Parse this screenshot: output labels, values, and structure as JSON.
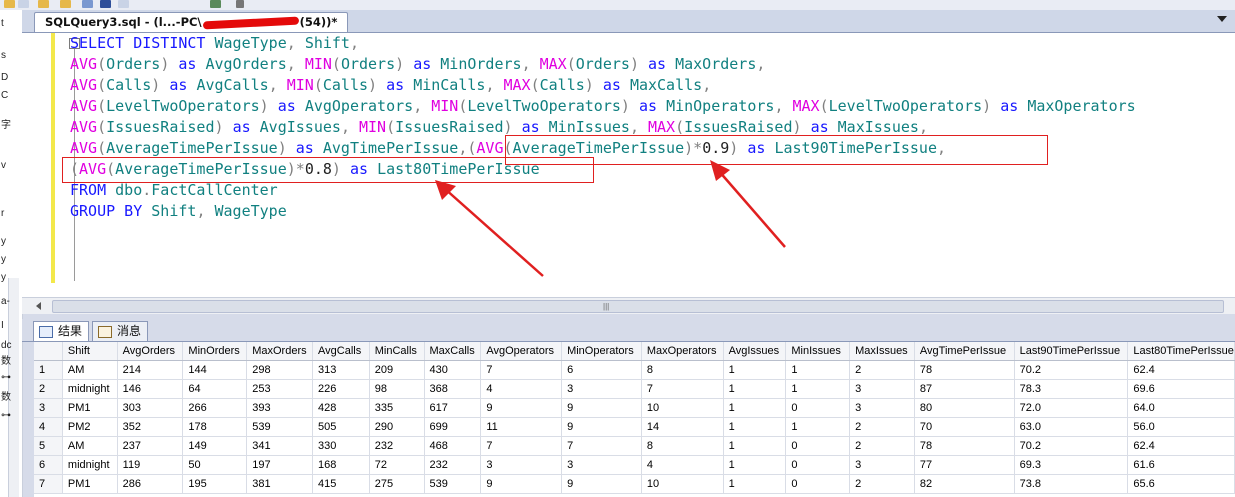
{
  "window": {
    "tab_title_prefix": "SQLQuery3.sql - (l...-PC\\",
    "tab_title_suffix": "(54))*"
  },
  "left_strip_glyphs": [
    "t",
    "s",
    "D",
    "C",
    "字",
    "v",
    "r",
    "y",
    "y",
    "y",
    "a-",
    "I",
    "dc",
    "数",
    "⊶",
    "数",
    "⊶"
  ],
  "editor": {
    "lines": [
      [
        {
          "t": "SELECT DISTINCT ",
          "c": "kw"
        },
        {
          "t": "WageType",
          "c": "id"
        },
        {
          "t": ", ",
          "c": "op"
        },
        {
          "t": "Shift",
          "c": "id"
        },
        {
          "t": ",",
          "c": "op"
        }
      ],
      [
        {
          "t": "AVG",
          "c": "fn"
        },
        {
          "t": "(",
          "c": "op"
        },
        {
          "t": "Orders",
          "c": "id"
        },
        {
          "t": ") ",
          "c": "op"
        },
        {
          "t": "as ",
          "c": "kw"
        },
        {
          "t": "AvgOrders",
          "c": "id"
        },
        {
          "t": ", ",
          "c": "op"
        },
        {
          "t": "MIN",
          "c": "fn"
        },
        {
          "t": "(",
          "c": "op"
        },
        {
          "t": "Orders",
          "c": "id"
        },
        {
          "t": ") ",
          "c": "op"
        },
        {
          "t": "as ",
          "c": "kw"
        },
        {
          "t": "MinOrders",
          "c": "id"
        },
        {
          "t": ", ",
          "c": "op"
        },
        {
          "t": "MAX",
          "c": "fn"
        },
        {
          "t": "(",
          "c": "op"
        },
        {
          "t": "Orders",
          "c": "id"
        },
        {
          "t": ") ",
          "c": "op"
        },
        {
          "t": "as ",
          "c": "kw"
        },
        {
          "t": "MaxOrders",
          "c": "id"
        },
        {
          "t": ",",
          "c": "op"
        }
      ],
      [
        {
          "t": "AVG",
          "c": "fn"
        },
        {
          "t": "(",
          "c": "op"
        },
        {
          "t": "Calls",
          "c": "id"
        },
        {
          "t": ") ",
          "c": "op"
        },
        {
          "t": "as ",
          "c": "kw"
        },
        {
          "t": "AvgCalls",
          "c": "id"
        },
        {
          "t": ", ",
          "c": "op"
        },
        {
          "t": "MIN",
          "c": "fn"
        },
        {
          "t": "(",
          "c": "op"
        },
        {
          "t": "Calls",
          "c": "id"
        },
        {
          "t": ") ",
          "c": "op"
        },
        {
          "t": "as ",
          "c": "kw"
        },
        {
          "t": "MinCalls",
          "c": "id"
        },
        {
          "t": ", ",
          "c": "op"
        },
        {
          "t": "MAX",
          "c": "fn"
        },
        {
          "t": "(",
          "c": "op"
        },
        {
          "t": "Calls",
          "c": "id"
        },
        {
          "t": ") ",
          "c": "op"
        },
        {
          "t": "as ",
          "c": "kw"
        },
        {
          "t": "MaxCalls",
          "c": "id"
        },
        {
          "t": ",",
          "c": "op"
        }
      ],
      [
        {
          "t": "AVG",
          "c": "fn"
        },
        {
          "t": "(",
          "c": "op"
        },
        {
          "t": "LevelTwoOperators",
          "c": "id"
        },
        {
          "t": ") ",
          "c": "op"
        },
        {
          "t": "as ",
          "c": "kw"
        },
        {
          "t": "AvgOperators",
          "c": "id"
        },
        {
          "t": ", ",
          "c": "op"
        },
        {
          "t": "MIN",
          "c": "fn"
        },
        {
          "t": "(",
          "c": "op"
        },
        {
          "t": "LevelTwoOperators",
          "c": "id"
        },
        {
          "t": ") ",
          "c": "op"
        },
        {
          "t": "as ",
          "c": "kw"
        },
        {
          "t": "MinOperators",
          "c": "id"
        },
        {
          "t": ", ",
          "c": "op"
        },
        {
          "t": "MAX",
          "c": "fn"
        },
        {
          "t": "(",
          "c": "op"
        },
        {
          "t": "LevelTwoOperators",
          "c": "id"
        },
        {
          "t": ") ",
          "c": "op"
        },
        {
          "t": "as ",
          "c": "kw"
        },
        {
          "t": "MaxOperators",
          "c": "id"
        }
      ],
      [
        {
          "t": "AVG",
          "c": "fn"
        },
        {
          "t": "(",
          "c": "op"
        },
        {
          "t": "IssuesRaised",
          "c": "id"
        },
        {
          "t": ") ",
          "c": "op"
        },
        {
          "t": "as ",
          "c": "kw"
        },
        {
          "t": "AvgIssues",
          "c": "id"
        },
        {
          "t": ", ",
          "c": "op"
        },
        {
          "t": "MIN",
          "c": "fn"
        },
        {
          "t": "(",
          "c": "op"
        },
        {
          "t": "IssuesRaised",
          "c": "id"
        },
        {
          "t": ") ",
          "c": "op"
        },
        {
          "t": "as ",
          "c": "kw"
        },
        {
          "t": "MinIssues",
          "c": "id"
        },
        {
          "t": ", ",
          "c": "op"
        },
        {
          "t": "MAX",
          "c": "fn"
        },
        {
          "t": "(",
          "c": "op"
        },
        {
          "t": "IssuesRaised",
          "c": "id"
        },
        {
          "t": ") ",
          "c": "op"
        },
        {
          "t": "as ",
          "c": "kw"
        },
        {
          "t": "MaxIssues",
          "c": "id"
        },
        {
          "t": ",",
          "c": "op"
        }
      ],
      [
        {
          "t": "AVG",
          "c": "fn"
        },
        {
          "t": "(",
          "c": "op"
        },
        {
          "t": "AverageTimePerIssue",
          "c": "id"
        },
        {
          "t": ") ",
          "c": "op"
        },
        {
          "t": "as ",
          "c": "kw"
        },
        {
          "t": "AvgTimePerIssue",
          "c": "id"
        },
        {
          "t": ",",
          "c": "op"
        },
        {
          "t": "(",
          "c": "op"
        },
        {
          "t": "AVG",
          "c": "fn"
        },
        {
          "t": "(",
          "c": "op"
        },
        {
          "t": "AverageTimePerIssue",
          "c": "id"
        },
        {
          "t": ")*",
          "c": "op"
        },
        {
          "t": "0.9",
          "c": "num"
        },
        {
          "t": ") ",
          "c": "op"
        },
        {
          "t": "as ",
          "c": "kw"
        },
        {
          "t": "Last90TimePerIssue",
          "c": "id"
        },
        {
          "t": ",",
          "c": "op"
        }
      ],
      [
        {
          "t": "(",
          "c": "op"
        },
        {
          "t": "AVG",
          "c": "fn"
        },
        {
          "t": "(",
          "c": "op"
        },
        {
          "t": "AverageTimePerIssue",
          "c": "id"
        },
        {
          "t": ")*",
          "c": "op"
        },
        {
          "t": "0.8",
          "c": "num"
        },
        {
          "t": ") ",
          "c": "op"
        },
        {
          "t": "as ",
          "c": "kw"
        },
        {
          "t": "Last80TimePerIssue",
          "c": "id"
        }
      ],
      [
        {
          "t": "FROM ",
          "c": "kw"
        },
        {
          "t": "dbo",
          "c": "id"
        },
        {
          "t": ".",
          "c": "op"
        },
        {
          "t": "FactCallCenter",
          "c": "id"
        }
      ],
      [
        {
          "t": "GROUP BY ",
          "c": "kw"
        },
        {
          "t": "Shift",
          "c": "id"
        },
        {
          "t": ", ",
          "c": "op"
        },
        {
          "t": "WageType",
          "c": "id"
        }
      ]
    ]
  },
  "results": {
    "tabs": [
      {
        "label": "结果"
      },
      {
        "label": "消息"
      }
    ],
    "columns": [
      "",
      "Shift",
      "AvgOrders",
      "MinOrders",
      "MaxOrders",
      "AvgCalls",
      "MinCalls",
      "MaxCalls",
      "AvgOperators",
      "MinOperators",
      "MaxOperators",
      "AvgIssues",
      "MinIssues",
      "MaxIssues",
      "AvgTimePerIssue",
      "Last90TimePerIssue",
      "Last80TimePerIssue"
    ],
    "rows": [
      [
        "1",
        "AM",
        "214",
        "144",
        "298",
        "313",
        "209",
        "430",
        "7",
        "6",
        "8",
        "1",
        "1",
        "2",
        "78",
        "70.2",
        "62.4"
      ],
      [
        "2",
        "midnight",
        "146",
        "64",
        "253",
        "226",
        "98",
        "368",
        "4",
        "3",
        "7",
        "1",
        "1",
        "3",
        "87",
        "78.3",
        "69.6"
      ],
      [
        "3",
        "PM1",
        "303",
        "266",
        "393",
        "428",
        "335",
        "617",
        "9",
        "9",
        "10",
        "1",
        "0",
        "3",
        "80",
        "72.0",
        "64.0"
      ],
      [
        "4",
        "PM2",
        "352",
        "178",
        "539",
        "505",
        "290",
        "699",
        "11",
        "9",
        "14",
        "1",
        "1",
        "2",
        "70",
        "63.0",
        "56.0"
      ],
      [
        "5",
        "AM",
        "237",
        "149",
        "341",
        "330",
        "232",
        "468",
        "7",
        "7",
        "8",
        "1",
        "0",
        "2",
        "78",
        "70.2",
        "62.4"
      ],
      [
        "6",
        "midnight",
        "119",
        "50",
        "197",
        "168",
        "72",
        "232",
        "3",
        "3",
        "4",
        "1",
        "0",
        "3",
        "77",
        "69.3",
        "61.6"
      ],
      [
        "7",
        "PM1",
        "286",
        "195",
        "381",
        "415",
        "275",
        "539",
        "9",
        "9",
        "10",
        "1",
        "0",
        "2",
        "82",
        "73.8",
        "65.6"
      ]
    ]
  },
  "colors": {
    "keyword": "#1818ff",
    "function": "#e000e0",
    "identifier": "#118080",
    "operator": "#808080",
    "annotation": "#e02020"
  }
}
